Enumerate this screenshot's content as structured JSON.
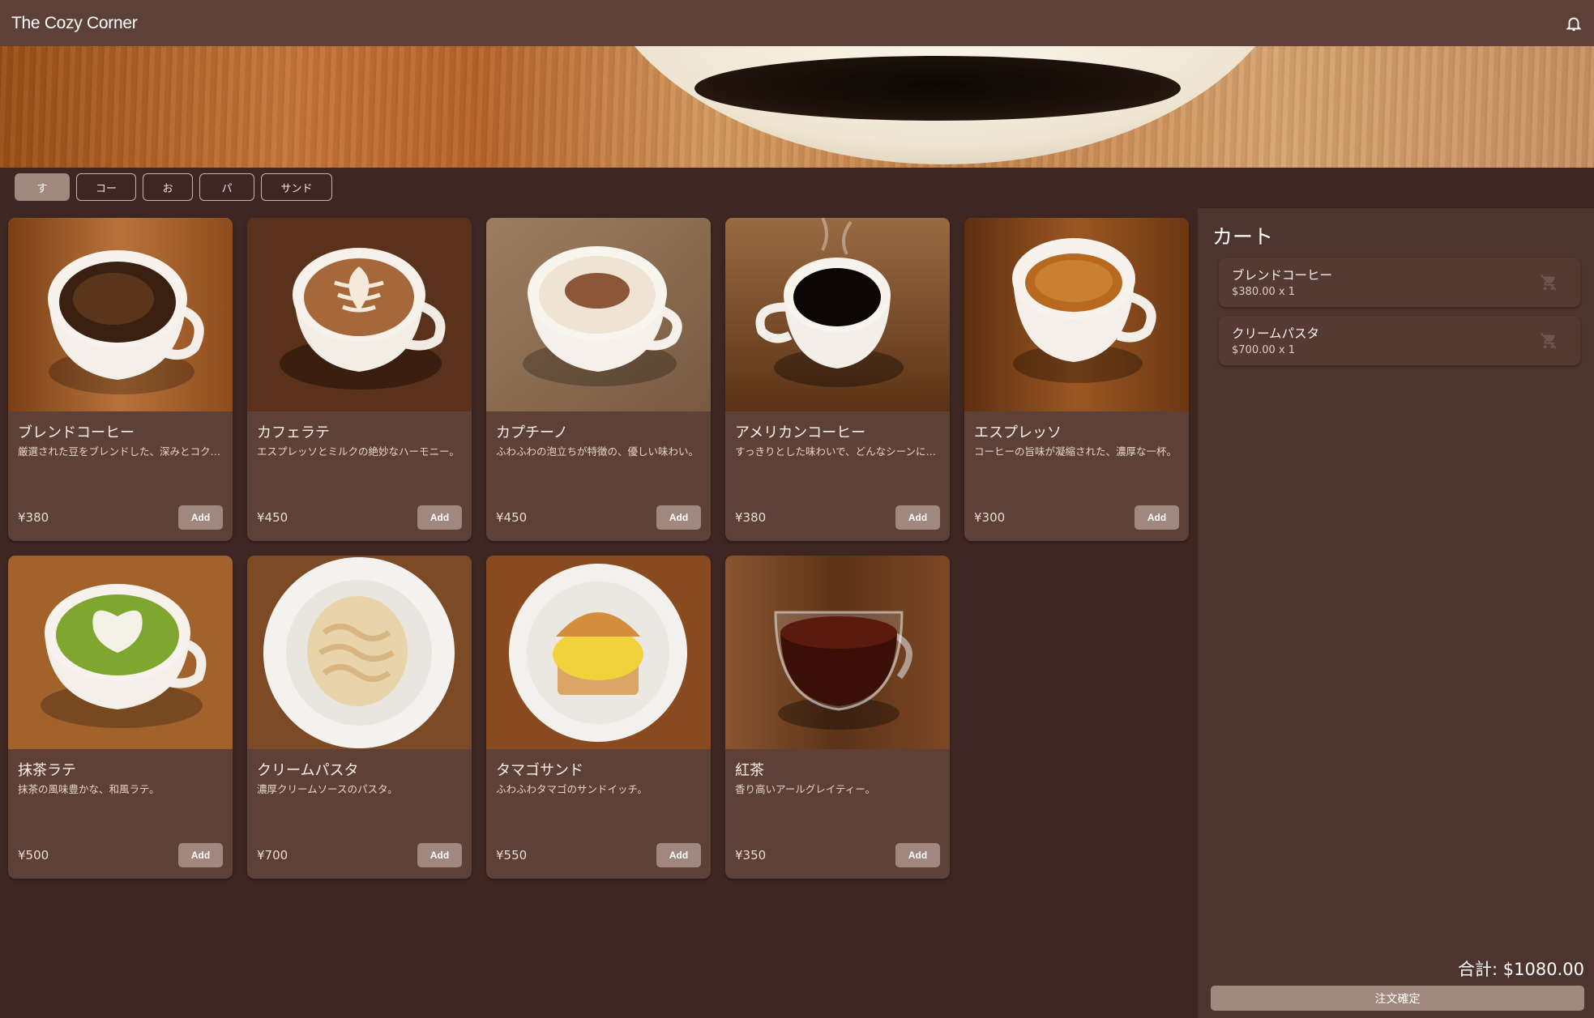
{
  "app": {
    "title": "The Cozy Corner"
  },
  "categories": [
    "す",
    "コー",
    "お",
    "パ",
    "サンド"
  ],
  "menu": [
    {
      "name": "ブレンドコーヒー",
      "desc": "厳選された豆をブレンドした、深みとコク…",
      "price": "¥380",
      "add": "Add",
      "photo": "blend-coffee"
    },
    {
      "name": "カフェラテ",
      "desc": "エスプレッソとミルクの絶妙なハーモニー。",
      "price": "¥450",
      "add": "Add",
      "photo": "cafe-latte"
    },
    {
      "name": "カプチーノ",
      "desc": "ふわふわの泡立ちが特徴の、優しい味わい。",
      "price": "¥450",
      "add": "Add",
      "photo": "cappuccino"
    },
    {
      "name": "アメリカンコーヒー",
      "desc": "すっきりとした味わいで、どんなシーンにも…",
      "price": "¥380",
      "add": "Add",
      "photo": "american-coffee"
    },
    {
      "name": "エスプレッソ",
      "desc": "コーヒーの旨味が凝縮された、濃厚な一杯。",
      "price": "¥300",
      "add": "Add",
      "photo": "espresso"
    },
    {
      "name": "抹茶ラテ",
      "desc": "抹茶の風味豊かな、和風ラテ。",
      "price": "¥500",
      "add": "Add",
      "photo": "matcha-latte"
    },
    {
      "name": "クリームパスタ",
      "desc": "濃厚クリームソースのパスタ。",
      "price": "¥700",
      "add": "Add",
      "photo": "cream-pasta"
    },
    {
      "name": "タマゴサンド",
      "desc": "ふわふわタマゴのサンドイッチ。",
      "price": "¥550",
      "add": "Add",
      "photo": "egg-sandwich"
    },
    {
      "name": "紅茶",
      "desc": "香り高いアールグレイティー。",
      "price": "¥350",
      "add": "Add",
      "photo": "black-tea"
    }
  ],
  "cart": {
    "title": "カート",
    "items": [
      {
        "name": "ブレンドコーヒー",
        "qty": "$380.00 x 1"
      },
      {
        "name": "クリームパスタ",
        "qty": "$700.00 x 1"
      }
    ],
    "total": "合計: $1080.00",
    "confirm": "注文確定"
  },
  "colors": {
    "appbar": "#5d4037",
    "background": "#3e2723",
    "card": "#5d4037",
    "button": "#a1887f",
    "cart_panel": "#4e342e"
  },
  "icons": {
    "appbar": "notification-bell-icon",
    "cart_remove": "remove-shopping-cart-icon"
  }
}
